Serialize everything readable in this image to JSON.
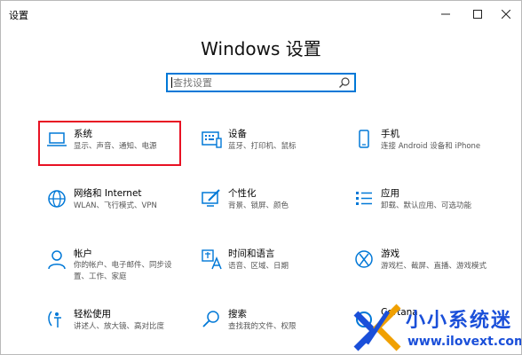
{
  "window": {
    "title": "设置"
  },
  "heading": "Windows 设置",
  "search": {
    "placeholder": "查找设置",
    "icon": "search-icon"
  },
  "accent": "#0078d7",
  "highlight_color": "#e81123",
  "tiles": [
    {
      "name": "系统",
      "desc": "显示、声音、通知、电源",
      "icon": "laptop-icon"
    },
    {
      "name": "设备",
      "desc": "蓝牙、打印机、鼠标",
      "icon": "keyboard-device-icon"
    },
    {
      "name": "手机",
      "desc": "连接 Android 设备和 iPhone",
      "icon": "phone-icon"
    },
    {
      "name": "网络和 Internet",
      "desc": "WLAN、飞行模式、VPN",
      "icon": "globe-icon"
    },
    {
      "name": "个性化",
      "desc": "背景、锁屏、颜色",
      "icon": "paint-monitor-icon"
    },
    {
      "name": "应用",
      "desc": "卸载、默认应用、可选功能",
      "icon": "apps-list-icon"
    },
    {
      "name": "帐户",
      "desc": "你的帐户、电子邮件、同步设\n置、工作、家庭",
      "icon": "person-icon"
    },
    {
      "name": "时间和语言",
      "desc": "语音、区域、日期",
      "icon": "time-language-icon"
    },
    {
      "name": "游戏",
      "desc": "游戏栏、截屏、直播、游戏模式",
      "icon": "xbox-icon"
    },
    {
      "name": "轻松使用",
      "desc": "讲述人、放大镜、高对比度",
      "icon": "ease-of-access-icon"
    },
    {
      "name": "搜索",
      "desc": "查找我的文件、权限",
      "icon": "magnifier-icon"
    },
    {
      "name": "Cortana",
      "desc": "",
      "icon": "cortana-icon"
    }
  ],
  "selected_tile": "系统",
  "watermark": {
    "text": "小小系统迷",
    "url": "www.ilovext.com"
  }
}
